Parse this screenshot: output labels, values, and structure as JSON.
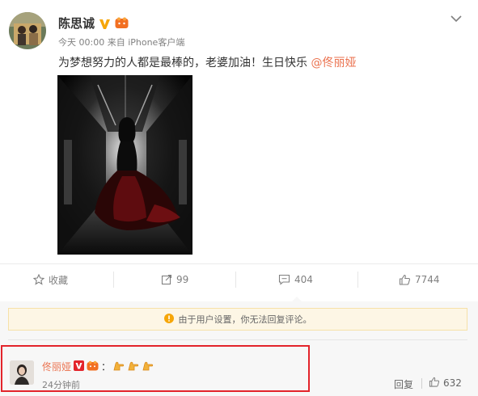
{
  "post": {
    "author": "陈思诚",
    "meta": "今天 00:00 来自 iPhone客户端",
    "text": "为梦想努力的人都是最棒的，老婆加油！生日快乐 ",
    "mention": "@佟丽娅"
  },
  "actions": {
    "favorite_label": "收藏",
    "repost_count": "99",
    "comment_count": "404",
    "like_count": "7744"
  },
  "notice": {
    "text": "由于用户设置，你无法回复评论。"
  },
  "comment": {
    "author": "佟丽娅",
    "colon": "：",
    "time": "24分钟前",
    "reply_label": "回复",
    "like_count": "632"
  },
  "colors": {
    "link": "#eb7350",
    "highlight": "#e3242b",
    "notice_bg": "#fdf6e5",
    "vip": "#f6a609"
  },
  "icons": [
    "chevron-down-icon",
    "star-icon",
    "repost-icon",
    "comment-icon",
    "thumbs-up-icon",
    "info-icon",
    "vip-badge-icon",
    "member-badge-icon",
    "emoji-icon"
  ]
}
